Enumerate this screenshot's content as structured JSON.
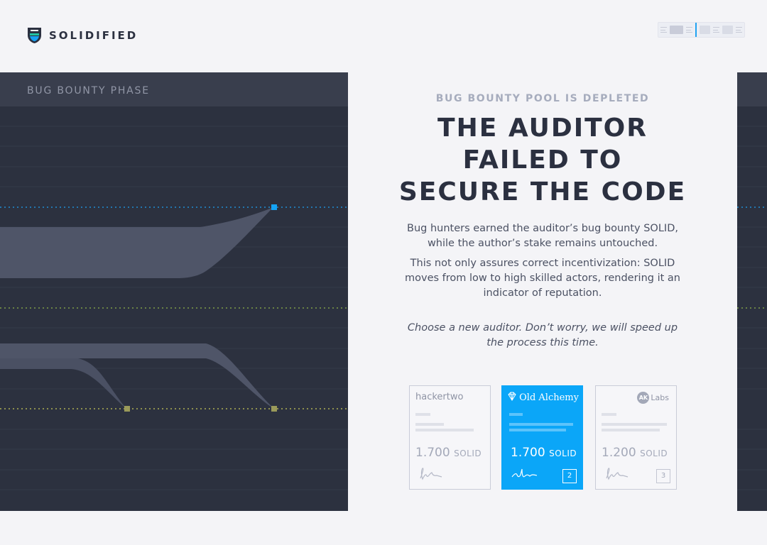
{
  "brand": {
    "name": "SOLIDIFIED"
  },
  "phase": {
    "title": "BUG BOUNTY PHASE"
  },
  "content": {
    "kicker": "BUG BOUNTY POOL IS DEPLETED",
    "headline": "THE AUDITOR FAILED TO SECURE THE CODE",
    "paragraph1": "Bug hunters earned the auditor’s bug bounty SOLID, while the author’s stake remains untouched.",
    "paragraph2": "This not only assures correct incentivization: SOLID moves from low to high skilled actors, rendering it an indicator of reputation.",
    "note": "Choose a new auditor. Don’t worry, we will speed up the process this time."
  },
  "auditors": [
    {
      "name": "hackertwo",
      "amount": "1.700",
      "unit": "SOLID",
      "rank": "",
      "selected": false
    },
    {
      "name": "Old Alchemy",
      "amount": "1.700",
      "unit": "SOLID",
      "rank": "2",
      "selected": true
    },
    {
      "badge": "AK",
      "name": "Labs",
      "amount": "1.200",
      "unit": "SOLID",
      "rank": "3",
      "selected": false
    }
  ],
  "colors": {
    "accent": "#0ba6f8",
    "panel": "#2c313f",
    "blue_line": "#1e9ff0",
    "green_line": "#8fb24a",
    "yellow_line": "#c9c957"
  },
  "icons": [
    "shield-logo-icon",
    "diamond-icon",
    "signature-icon"
  ]
}
